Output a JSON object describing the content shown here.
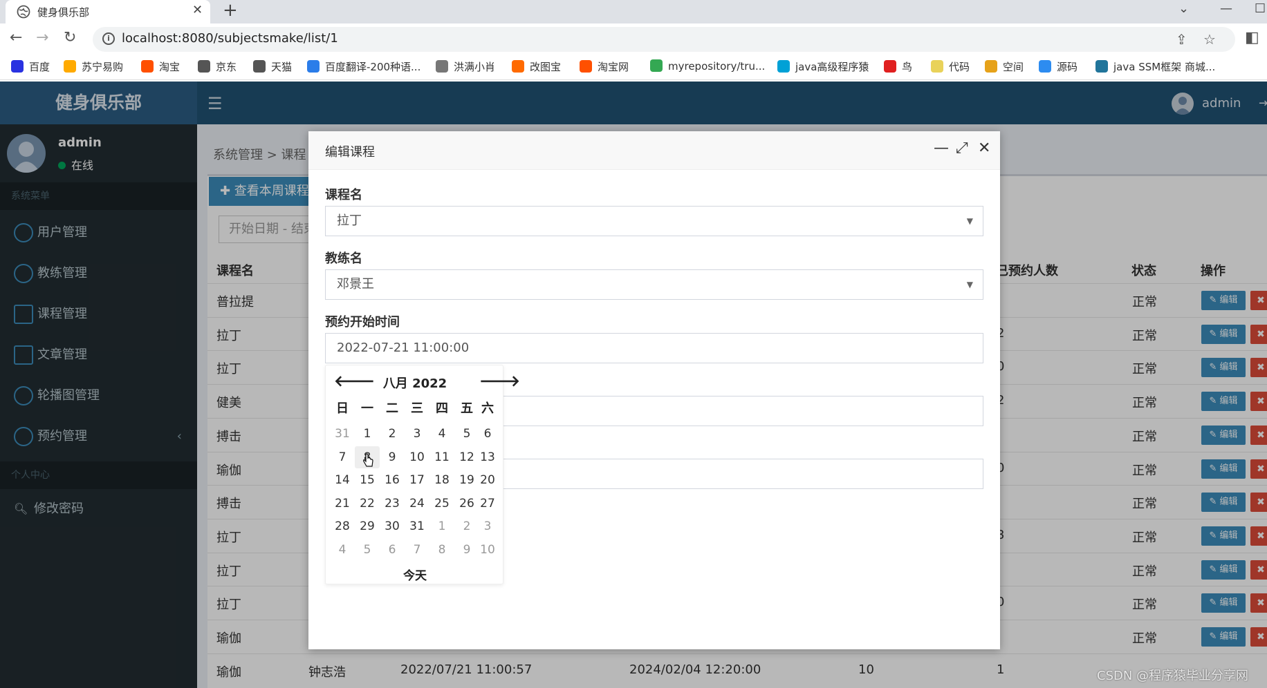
{
  "browser": {
    "tab_title": "健身俱乐部",
    "url": "localhost:8080/subjectsmake/list/1",
    "bookmarks": [
      {
        "label": "百度",
        "color": "#2932e1"
      },
      {
        "label": "苏宁易购",
        "color": "#ffaa00"
      },
      {
        "label": "淘宝",
        "color": "#ff5000"
      },
      {
        "label": "京东",
        "color": "#555555"
      },
      {
        "label": "天猫",
        "color": "#555555"
      },
      {
        "label": "百度翻译-200种语...",
        "color": "#2b7de9"
      },
      {
        "label": "洪满小肖",
        "color": "#777777"
      },
      {
        "label": "改图宝",
        "color": "#ff6a00"
      },
      {
        "label": "淘宝网",
        "color": "#ff5000"
      },
      {
        "label": "myrepository/tru...",
        "color": "#34a853"
      },
      {
        "label": "java高级程序猿",
        "color": "#00a1d6"
      },
      {
        "label": "鸟",
        "color": "#e02020"
      },
      {
        "label": "代码",
        "color": "#e9d25a"
      },
      {
        "label": "空间",
        "color": "#e6a21a"
      },
      {
        "label": "源码",
        "color": "#2d8cf0"
      },
      {
        "label": "java SSM框架 商城...",
        "color": "#21759b"
      }
    ]
  },
  "app": {
    "brand": "健身俱乐部",
    "user": "admin",
    "status": "在线",
    "accent": "#3c8dbc"
  },
  "sidebar": {
    "section_system": "系统菜单",
    "items": [
      {
        "label": "用户管理"
      },
      {
        "label": "教练管理"
      },
      {
        "label": "课程管理"
      },
      {
        "label": "文章管理"
      },
      {
        "label": "轮播图管理"
      },
      {
        "label": "预约管理",
        "caret": "‹"
      }
    ],
    "section_personal": "个人中心",
    "change_password": "修改密码"
  },
  "main": {
    "breadcrumb": "系统管理 > 课程",
    "week_button": "✚ 查看本周课程",
    "date_range_placeholder": "开始日期 - 结束",
    "columns": {
      "course": "课程名",
      "booked": "已预约人数",
      "status": "状态",
      "actions": "操作"
    },
    "edit_label": "✎ 编辑",
    "delete_label": "✖",
    "rows": [
      {
        "course": "普拉提",
        "booked": "",
        "status": "正常"
      },
      {
        "course": "拉丁",
        "booked": "2",
        "status": "正常"
      },
      {
        "course": "拉丁",
        "booked": "0",
        "status": "正常"
      },
      {
        "course": "健美",
        "booked": "2",
        "status": "正常"
      },
      {
        "course": "搏击",
        "booked": "",
        "status": "正常"
      },
      {
        "course": "瑜伽",
        "booked": "0",
        "status": "正常"
      },
      {
        "course": "搏击",
        "booked": "",
        "status": "正常"
      },
      {
        "course": "拉丁",
        "booked": "3",
        "status": "正常"
      },
      {
        "course": "拉丁",
        "booked": "",
        "status": "正常"
      },
      {
        "course": "拉丁",
        "booked": "0",
        "status": "正常"
      },
      {
        "course": "瑜伽",
        "booked": "",
        "status": "正常"
      }
    ],
    "last_row": {
      "course": "瑜伽",
      "coach": "钟志浩",
      "start": "2022/07/21 11:00:57",
      "end": "2024/02/04 12:20:00",
      "capacity": "10",
      "booked": "1"
    }
  },
  "modal": {
    "title": "编辑课程",
    "fields": {
      "course_label": "课程名",
      "course_value": "拉丁",
      "coach_label": "教练名",
      "coach_value": "邓景王",
      "start_label": "预约开始时间",
      "start_value": "2022-07-21 11:00:00"
    }
  },
  "datepicker": {
    "title": "八月 2022",
    "prev": "🡐",
    "next": "🡒",
    "weekdays": [
      "日",
      "一",
      "二",
      "三",
      "四",
      "五",
      "六"
    ],
    "weeks": [
      [
        "31",
        "1",
        "2",
        "3",
        "4",
        "5",
        "6"
      ],
      [
        "7",
        "8",
        "9",
        "10",
        "11",
        "12",
        "13"
      ],
      [
        "14",
        "15",
        "16",
        "17",
        "18",
        "19",
        "20"
      ],
      [
        "21",
        "22",
        "23",
        "24",
        "25",
        "26",
        "27"
      ],
      [
        "28",
        "29",
        "30",
        "31",
        "1",
        "2",
        "3"
      ],
      [
        "4",
        "5",
        "6",
        "7",
        "8",
        "9",
        "10"
      ]
    ],
    "hovered_day": "8",
    "today_label": "今天"
  },
  "watermark": "CSDN @程序猿毕业分享网"
}
